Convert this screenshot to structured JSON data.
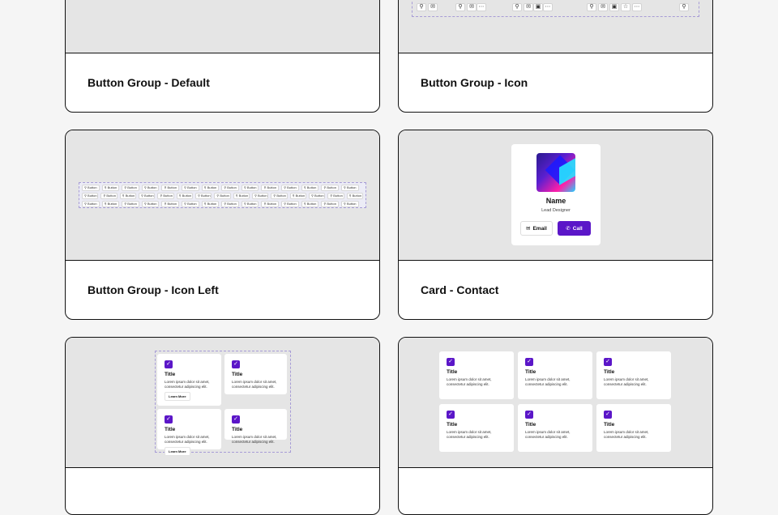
{
  "cards": [
    {
      "title": "Button Group - Default"
    },
    {
      "title": "Button Group - Icon"
    },
    {
      "title": "Button Group - Icon Left"
    },
    {
      "title": "Card - Contact"
    }
  ],
  "icon_group": {
    "icons": [
      "link",
      "mail",
      "link",
      "mail",
      "more",
      "link",
      "mail",
      "copy",
      "more",
      "link",
      "mail",
      "copy",
      "star",
      "more",
      "link"
    ]
  },
  "icon_left": {
    "button_label": "Button",
    "rows": [
      [
        "Button",
        "Button",
        "Button",
        "Button",
        "Button",
        "Button",
        "Button",
        "Button",
        "Button",
        "Button",
        "Button",
        "Button",
        "Button",
        "Button"
      ],
      [
        "Button",
        "Button",
        "Button",
        "Button",
        "Button",
        "Button",
        "Button",
        "Button",
        "Button",
        "Button",
        "Button",
        "Button",
        "Button",
        "Button",
        "Button"
      ],
      [
        "Button",
        "Button",
        "Button",
        "Button",
        "Button",
        "Button",
        "Button",
        "Button",
        "Button",
        "Button",
        "Button",
        "Button",
        "Button",
        "Button"
      ]
    ]
  },
  "contact": {
    "name": "Name",
    "role": "Lead Designer",
    "email_label": "Email",
    "call_label": "Call",
    "accent": "#5b16c8"
  },
  "feature_tiles": {
    "title": "Title",
    "desc": "Lorem ipsum dolor sit amet, consectetur adipiscing elit.",
    "cta": "Learn More"
  }
}
